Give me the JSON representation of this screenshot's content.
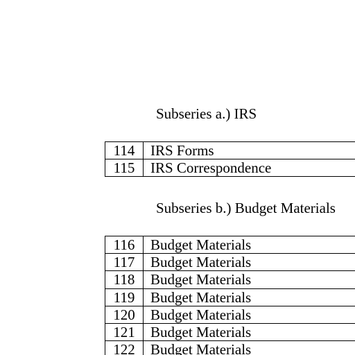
{
  "subseries_a": {
    "heading": "Subseries a.) IRS",
    "rows": [
      {
        "num": "114",
        "desc": "IRS Forms"
      },
      {
        "num": "115",
        "desc": "IRS Correspondence"
      }
    ]
  },
  "subseries_b": {
    "heading": "Subseries b.) Budget Materials",
    "rows": [
      {
        "num": "116",
        "desc": "Budget Materials"
      },
      {
        "num": "117",
        "desc": "Budget Materials"
      },
      {
        "num": "118",
        "desc": "Budget Materials"
      },
      {
        "num": "119",
        "desc": "Budget Materials"
      },
      {
        "num": "120",
        "desc": "Budget Materials"
      },
      {
        "num": "121",
        "desc": "Budget Materials"
      },
      {
        "num": "122",
        "desc": "Budget Materials"
      }
    ]
  }
}
